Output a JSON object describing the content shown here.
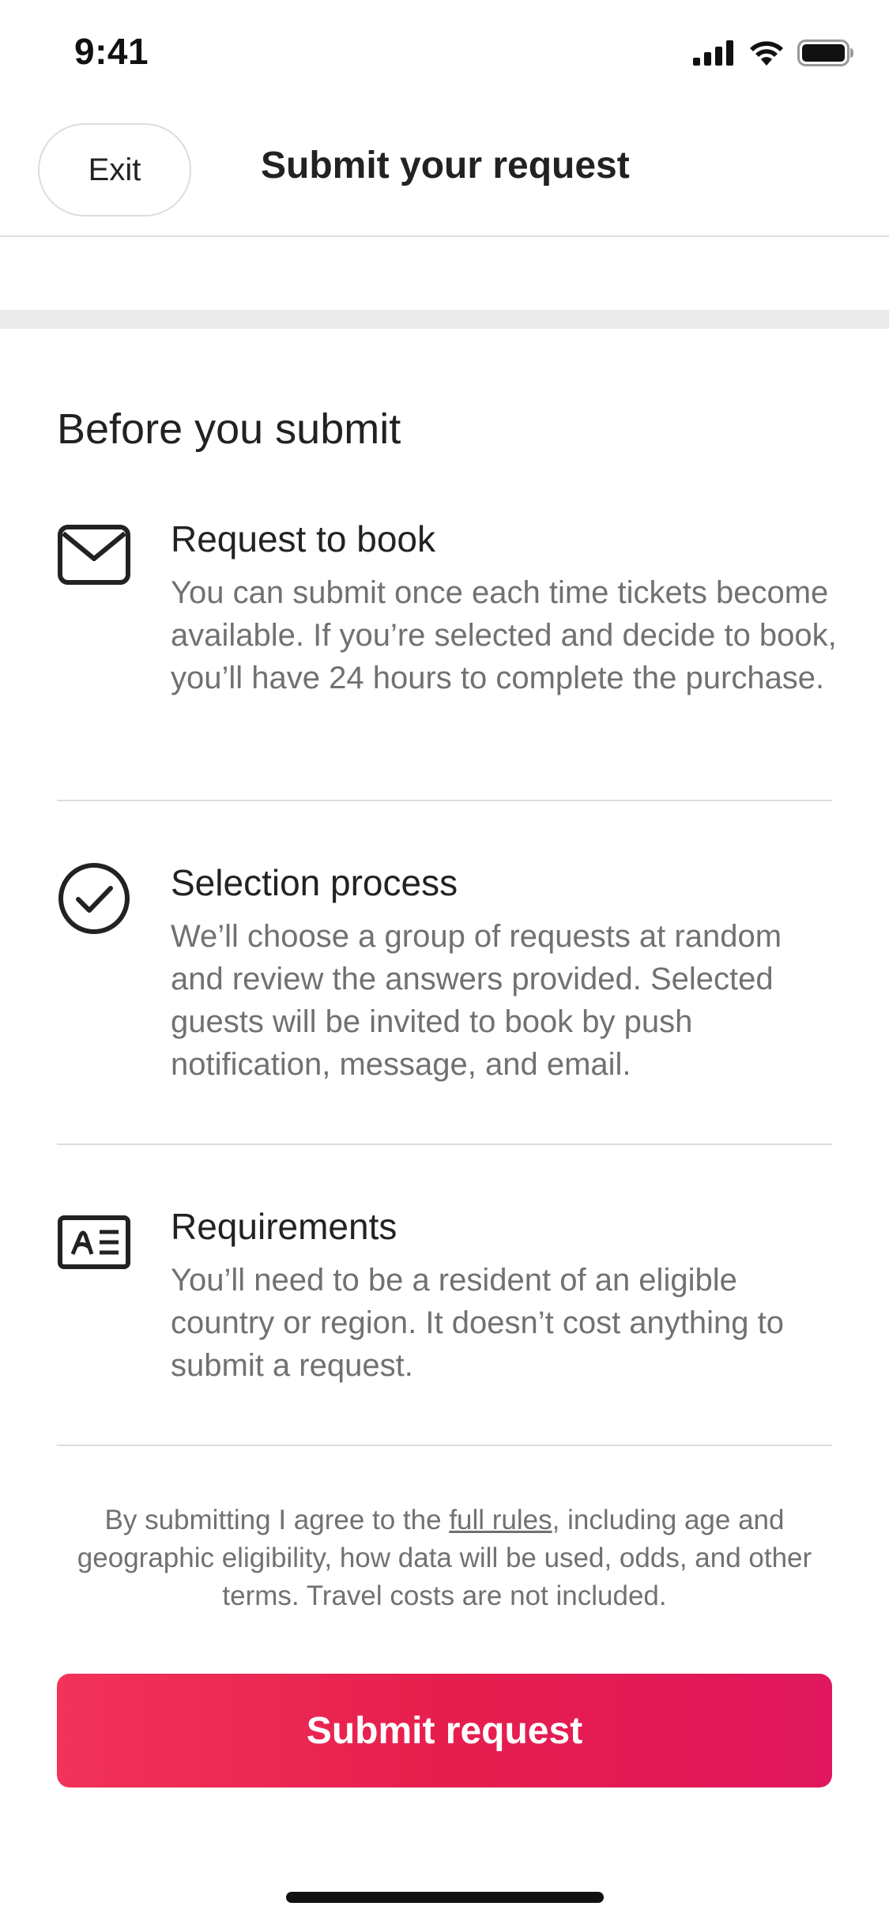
{
  "status_bar": {
    "time": "9:41"
  },
  "header": {
    "exit_label": "Exit",
    "title": "Submit your request"
  },
  "main": {
    "section_title": "Before you submit",
    "items": [
      {
        "icon": "envelope-icon",
        "title": "Request to book",
        "description": "You can submit once each time tickets become available. If you’re selected and decide to book, you’ll have 24 hours to complete the purchase."
      },
      {
        "icon": "check-circle-icon",
        "title": "Selection process",
        "description": "We’ll choose a group of requests at random and review the answers provided. Selected guests will be invited to book by push notification, message, and email."
      },
      {
        "icon": "id-card-icon",
        "title": "Requirements",
        "description": "You’ll need to be a resident of an eligible country or region. It doesn’t cost anything to submit a request."
      }
    ],
    "legal": {
      "prefix": "By submitting I agree to the ",
      "link_label": "full rules",
      "suffix": ", including age and geographic eligibility, how data will be used, odds, and other terms. Travel costs are not included."
    },
    "submit_label": "Submit request"
  },
  "colors": {
    "brand": "#e61e4d",
    "text_primary": "#222222",
    "text_secondary": "#717171",
    "divider": "#dddddd"
  }
}
